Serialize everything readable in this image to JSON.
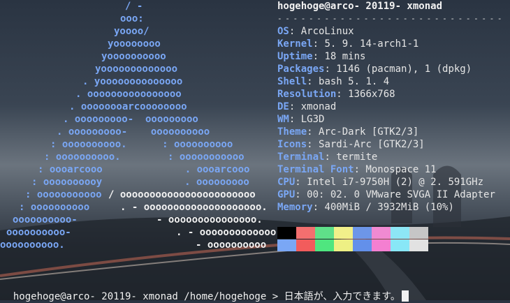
{
  "logo_lines": [
    "/ -",
    "ooo:",
    "yoooo/",
    "yoooooooo",
    "yoooooooooo",
    "yooooooooooooo",
    ". yoooooooooooooo",
    ". oooooooooooooooo",
    ". oooooooarcoooooooo",
    ". ooooooooo-  ooooooooo",
    ". ooooooooo-    oooooooooo",
    ": oooooooooo.      : oooooooooo",
    ": oooooooooo.        : ooooooooooo",
    ": oooarcooo              . oooarcooo",
    ": oooooooooy              . ooooooooo",
    ": ooooooooooo",
    "/ ooooooooooooooooooooooo",
    ": oooooooooo",
    ". - oooooooooooooooooooo.",
    "oooooooooo-",
    "- ooooooooooooooo.",
    "oooooooooo-",
    ". - ooooooooooooo.",
    "oooooooooo.",
    "- oooooooooo"
  ],
  "user_host": "hogehoge@arco- 20119- xmonad",
  "separator": "- - - - - - - - - - - - - - - - - - - - - - - - - - - - -",
  "info": [
    {
      "key": "OS",
      "value": "ArcoLinux"
    },
    {
      "key": "Kernel",
      "value": "5. 9. 14-arch1-1"
    },
    {
      "key": "Uptime",
      "value": "18 mins"
    },
    {
      "key": "Packages",
      "value": "1146 (pacman), 1 (dpkg)"
    },
    {
      "key": "Shell",
      "value": "bash 5. 1. 4"
    },
    {
      "key": "Resolution",
      "value": "1366x768"
    },
    {
      "key": "DE",
      "value": "xmonad"
    },
    {
      "key": "WM",
      "value": "LG3D"
    },
    {
      "key": "Theme",
      "value": "Arc-Dark [GTK2/3]"
    },
    {
      "key": "Icons",
      "value": "Sardi-Arc [GTK2/3]"
    },
    {
      "key": "Terminal",
      "value": "termite"
    },
    {
      "key": "Terminal Font",
      "value": "Monospace 11"
    },
    {
      "key": "CPU",
      "value": "Intel i7-9750H (2) @ 2. 591GHz"
    },
    {
      "key": "GPU",
      "value": "00: 02. 0 VMware SVGA II Adapter"
    },
    {
      "key": "Memory",
      "value": "400MiB / 3932MiB (10%)"
    }
  ],
  "colors_top": [
    "#000000",
    "#f36f6f",
    "#5fe089",
    "#f2f08a",
    "#6d96e8",
    "#f08ad2",
    "#8de6f5",
    "#c6c6c6"
  ],
  "colors_bottom": [
    "#7aa7f5",
    "#f25c5c",
    "#4fe67f",
    "#eef084",
    "#6390ea",
    "#f47fd1",
    "#88e7f7",
    "#e2e2e2"
  ],
  "prompt": "hogehoge@arco- 20119- xmonad /home/hogehoge > 日本語が、入力できます。"
}
